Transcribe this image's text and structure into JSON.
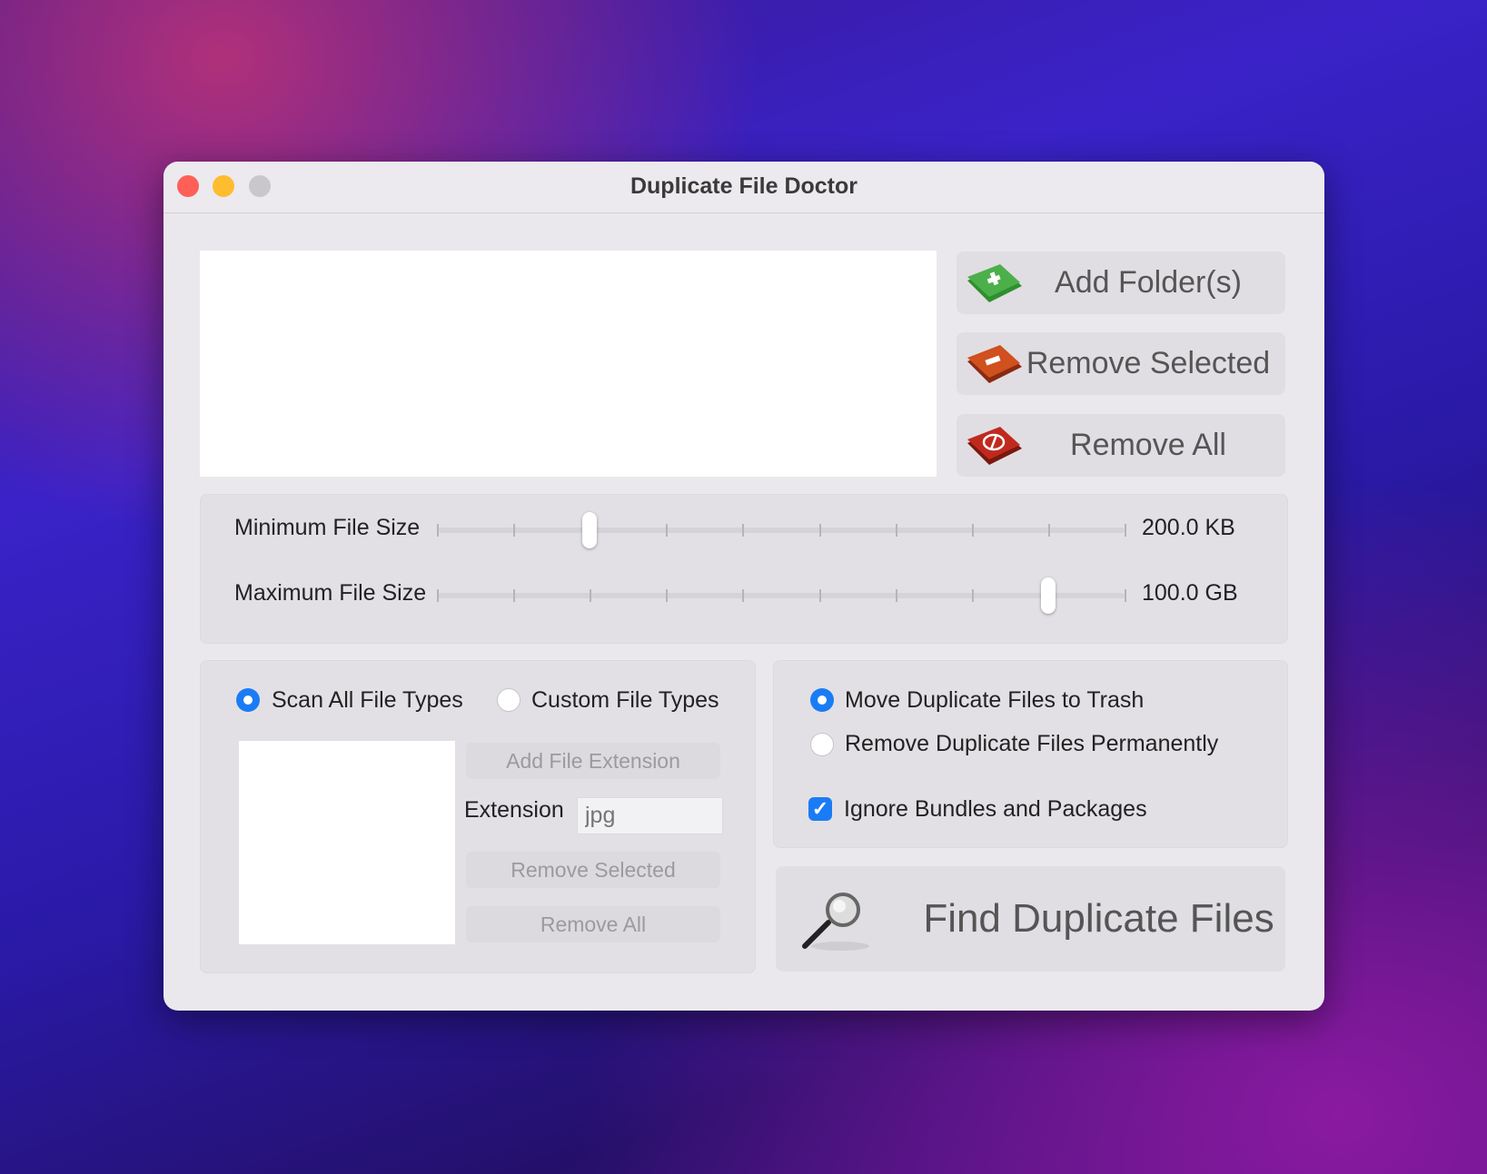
{
  "window": {
    "title": "Duplicate File Doctor",
    "colors": {
      "close": "#fe5f57",
      "minimize": "#febc2e",
      "zoom": "#c9c7cb"
    }
  },
  "folder_buttons": {
    "add": "Add Folder(s)",
    "remove_selected": "Remove Selected",
    "remove_all": "Remove All"
  },
  "size_filters": {
    "min": {
      "label": "Minimum File Size",
      "value": "200.0 KB",
      "position": 0.222
    },
    "max": {
      "label": "Maximum File Size",
      "value": "100.0 GB",
      "position": 0.889
    },
    "tick_count": 10
  },
  "file_types": {
    "scan_all": {
      "label": "Scan All File Types",
      "selected": true
    },
    "custom": {
      "label": "Custom File Types",
      "selected": false
    },
    "add_extension": "Add File Extension",
    "extension_label": "Extension",
    "extension_placeholder": "jpg",
    "remove_selected": "Remove Selected",
    "remove_all": "Remove All"
  },
  "actions": {
    "move_trash": {
      "label": "Move Duplicate Files to Trash",
      "selected": true
    },
    "remove_perm": {
      "label": "Remove Duplicate Files Permanently",
      "selected": false
    },
    "ignore_bundles": {
      "label": "Ignore Bundles and Packages",
      "checked": true
    }
  },
  "find_button": "Find Duplicate Files"
}
